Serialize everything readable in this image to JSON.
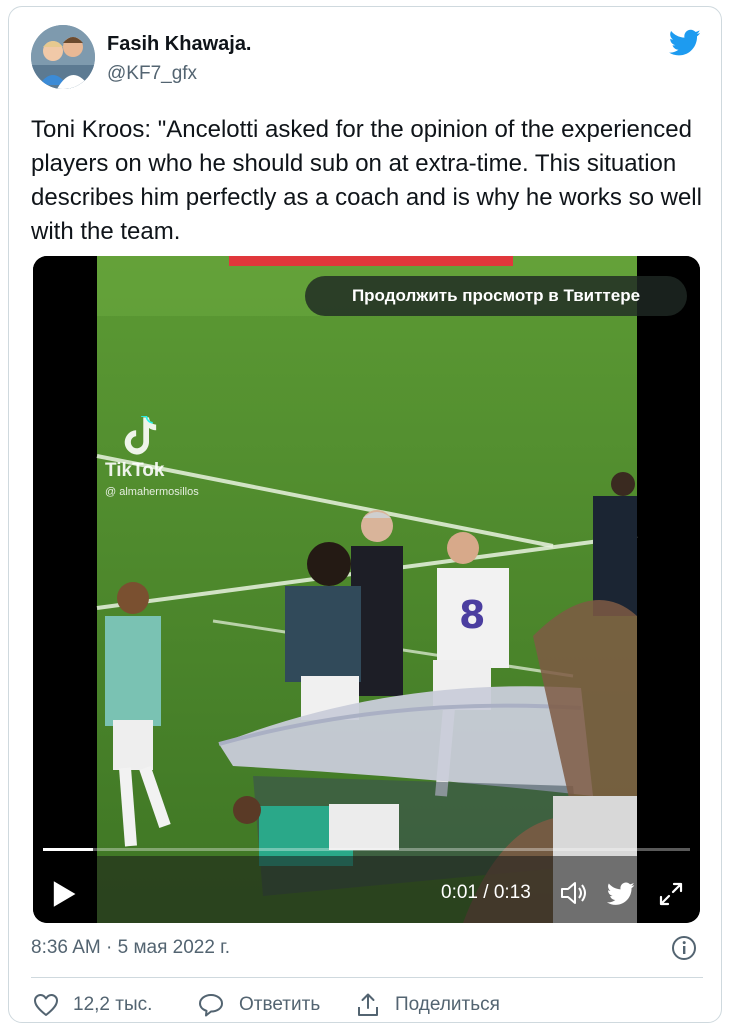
{
  "author": {
    "name": "Fasih Khawaja.",
    "handle": "@KF7_gfx"
  },
  "tweet": {
    "text": "Toni Kroos: \"Ancelotti asked for the opinion of the experienced players on who he should sub on at extra-time. This situation describes him perfectly as a coach and is why he works so well with the team."
  },
  "media": {
    "continue_label": "Продолжить просмотр в Твиттере",
    "watermark_brand": "TikTok",
    "watermark_user": "@ almahermosillos",
    "time_display": "0:01 / 0:13",
    "progress": 0.077
  },
  "footer": {
    "timestamp": "8:36 AM · 5 мая 2022 г.",
    "likes": "12,2 тыс.",
    "reply_label": "Ответить",
    "share_label": "Поделиться"
  },
  "icons": {
    "brand": "twitter-bird-icon",
    "like": "heart-icon",
    "reply": "speech-bubble-icon",
    "share": "share-arrow-icon",
    "info": "info-icon",
    "play": "play-icon",
    "volume": "volume-icon",
    "expand": "expand-icon"
  },
  "colors": {
    "twitter_blue": "#1d9bf0",
    "text_primary": "#0f1419",
    "text_secondary": "#536471",
    "pitch_green": "#4e8a2c"
  }
}
